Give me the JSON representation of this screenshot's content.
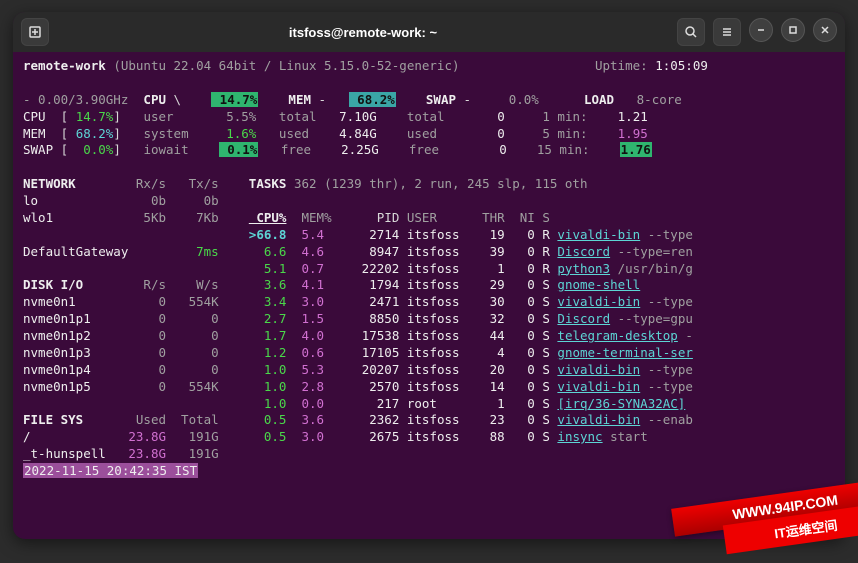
{
  "titlebar": {
    "title": "itsfoss@remote-work: ~"
  },
  "header": {
    "host": "remote-work",
    "os": "(Ubuntu 22.04 64bit / Linux 5.15.0-52-generic)",
    "uptime_label": "Uptime:",
    "uptime": "1:05:09"
  },
  "summary": {
    "freq": "- 0.00/3.90GHz",
    "cpu_label": "CPU",
    "cpu_bar": "\\",
    "cpu_pct": "14.7%",
    "mem_label": "MEM",
    "mem_dash": "-",
    "mem_pct": "68.2%",
    "swap_label": "SWAP",
    "swap_dash": "-",
    "swap_pct": "0.0%",
    "load_label": "LOAD",
    "cores": "8-core",
    "rows": [
      {
        "l1": "CPU",
        "l1v": "14.7%",
        "l2": "user",
        "l2v": "5.5%",
        "l3": "total",
        "l3v": "7.10G",
        "l4": "total",
        "l4v": "0",
        "l5": "1 min:",
        "l5v": "1.21"
      },
      {
        "l1": "MEM",
        "l1v": "68.2%",
        "l2": "system",
        "l2v": "1.6%",
        "l3": "used",
        "l3v": "4.84G",
        "l4": "used",
        "l4v": "0",
        "l5": "5 min:",
        "l5v": "1.95"
      },
      {
        "l1": "SWAP",
        "l1v": "0.0%",
        "l2": "iowait",
        "l2v": "0.1%",
        "l3": "free",
        "l3v": "2.25G",
        "l4": "free",
        "l4v": "0",
        "l5": "15 min:",
        "l5v": "1.76"
      }
    ]
  },
  "network": {
    "title": "NETWORK",
    "h1": "Rx/s",
    "h2": "Tx/s",
    "rows": [
      {
        "if": "lo",
        "rx": "0b",
        "tx": "0b"
      },
      {
        "if": "wlo1",
        "rx": "5Kb",
        "tx": "7Kb"
      }
    ],
    "gw_label": "DefaultGateway",
    "gw_val": "7ms"
  },
  "tasks": {
    "title": "TASKS",
    "summary": "362 (1239 thr), 2 run, 245 slp, 115 oth",
    "h": {
      "cpu": "CPU%",
      "mem": "MEM%",
      "pid": "PID",
      "user": "USER",
      "thr": "THR",
      "ni": "NI",
      "s": "S"
    },
    "rows": [
      {
        "cpu": "66.8",
        "mem": "5.4",
        "pid": "2714",
        "user": "itsfoss",
        "thr": "19",
        "ni": "0",
        "s": "R",
        "cmd": "vivaldi-bin",
        "args": "--type",
        "sel": true
      },
      {
        "cpu": "6.6",
        "mem": "4.6",
        "pid": "8947",
        "user": "itsfoss",
        "thr": "39",
        "ni": "0",
        "s": "R",
        "cmd": "Discord",
        "args": "--type=ren"
      },
      {
        "cpu": "5.1",
        "mem": "0.7",
        "pid": "22202",
        "user": "itsfoss",
        "thr": "1",
        "ni": "0",
        "s": "R",
        "cmd": "python3",
        "args": "/usr/bin/g"
      },
      {
        "cpu": "3.6",
        "mem": "4.1",
        "pid": "1794",
        "user": "itsfoss",
        "thr": "29",
        "ni": "0",
        "s": "S",
        "cmd": "gnome-shell",
        "args": ""
      },
      {
        "cpu": "3.4",
        "mem": "3.0",
        "pid": "2471",
        "user": "itsfoss",
        "thr": "30",
        "ni": "0",
        "s": "S",
        "cmd": "vivaldi-bin",
        "args": "--type"
      },
      {
        "cpu": "2.7",
        "mem": "1.5",
        "pid": "8850",
        "user": "itsfoss",
        "thr": "32",
        "ni": "0",
        "s": "S",
        "cmd": "Discord",
        "args": "--type=gpu"
      },
      {
        "cpu": "1.7",
        "mem": "4.0",
        "pid": "17538",
        "user": "itsfoss",
        "thr": "44",
        "ni": "0",
        "s": "S",
        "cmd": "telegram-desktop",
        "args": "-"
      },
      {
        "cpu": "1.2",
        "mem": "0.6",
        "pid": "17105",
        "user": "itsfoss",
        "thr": "4",
        "ni": "0",
        "s": "S",
        "cmd": "gnome-terminal-ser",
        "args": ""
      },
      {
        "cpu": "1.0",
        "mem": "5.3",
        "pid": "20207",
        "user": "itsfoss",
        "thr": "20",
        "ni": "0",
        "s": "S",
        "cmd": "vivaldi-bin",
        "args": "--type"
      },
      {
        "cpu": "1.0",
        "mem": "2.8",
        "pid": "2570",
        "user": "itsfoss",
        "thr": "14",
        "ni": "0",
        "s": "S",
        "cmd": "vivaldi-bin",
        "args": "--type"
      },
      {
        "cpu": "1.0",
        "mem": "0.0",
        "pid": "217",
        "user": "root",
        "thr": "1",
        "ni": "0",
        "s": "S",
        "cmd": "[irq/36-SYNA32AC]",
        "args": ""
      },
      {
        "cpu": "0.5",
        "mem": "3.6",
        "pid": "2362",
        "user": "itsfoss",
        "thr": "23",
        "ni": "0",
        "s": "S",
        "cmd": "vivaldi-bin",
        "args": "--enab"
      },
      {
        "cpu": "0.5",
        "mem": "3.0",
        "pid": "2675",
        "user": "itsfoss",
        "thr": "88",
        "ni": "0",
        "s": "S",
        "cmd": "insync",
        "args": "start"
      }
    ]
  },
  "disk": {
    "title": "DISK I/O",
    "h1": "R/s",
    "h2": "W/s",
    "rows": [
      {
        "d": "nvme0n1",
        "r": "0",
        "w": "554K"
      },
      {
        "d": "nvme0n1p1",
        "r": "0",
        "w": "0"
      },
      {
        "d": "nvme0n1p2",
        "r": "0",
        "w": "0"
      },
      {
        "d": "nvme0n1p3",
        "r": "0",
        "w": "0"
      },
      {
        "d": "nvme0n1p4",
        "r": "0",
        "w": "0"
      },
      {
        "d": "nvme0n1p5",
        "r": "0",
        "w": "554K"
      }
    ]
  },
  "fs": {
    "title": "FILE SYS",
    "h1": "Used",
    "h2": "Total",
    "rows": [
      {
        "m": "/",
        "u": "23.8G",
        "t": "191G"
      },
      {
        "m": "_t-hunspell",
        "u": "23.8G",
        "t": "191G"
      }
    ]
  },
  "footer": "2022-11-15 20:42:35 IST",
  "watermark": {
    "host": "WWW.94IP.COM",
    "brand": "IT运维空间"
  }
}
